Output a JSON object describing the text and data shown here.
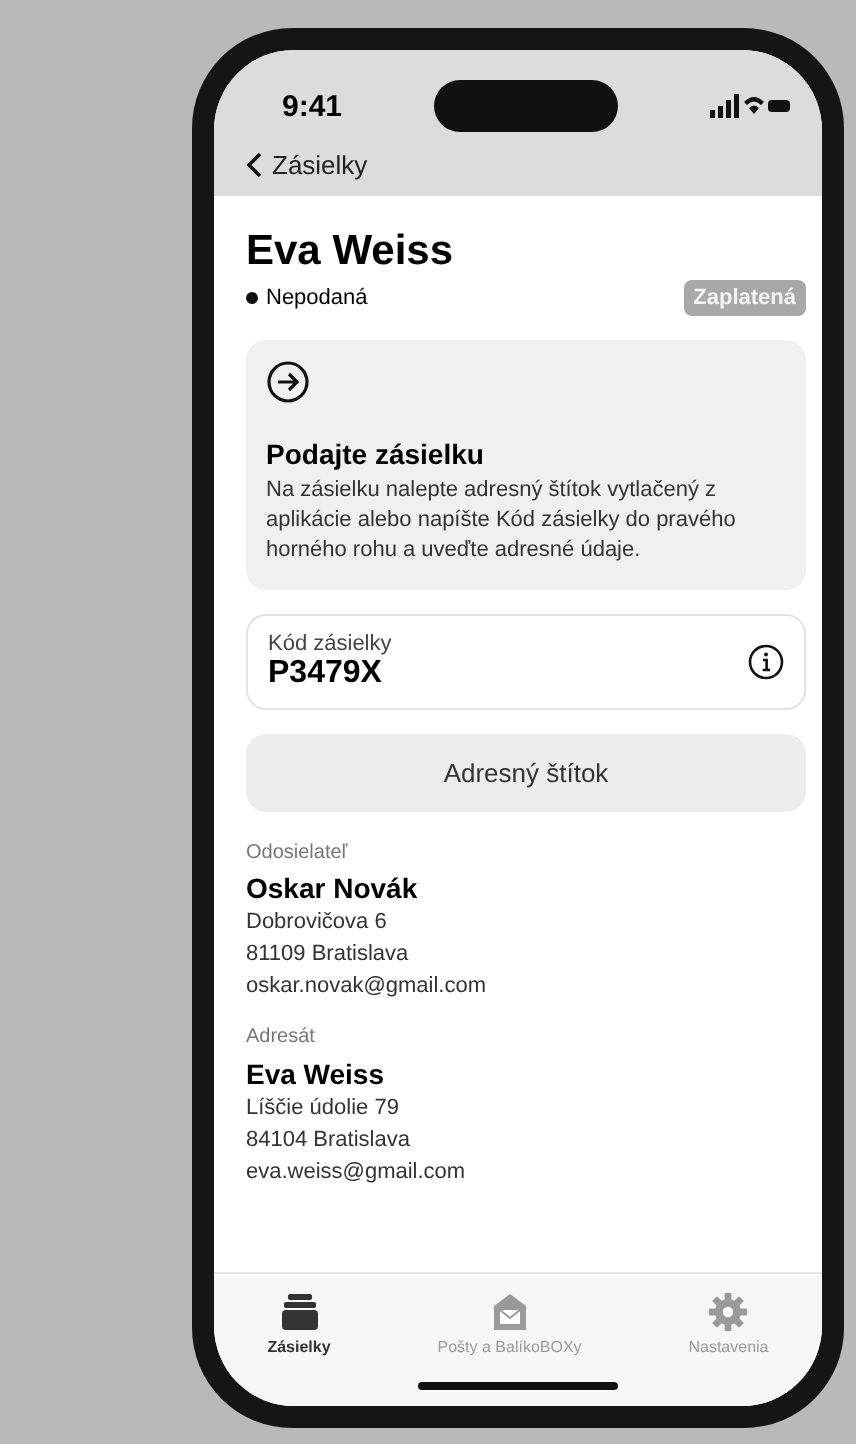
{
  "status_bar": {
    "time": "9:41"
  },
  "nav": {
    "back_label": "Zásielky"
  },
  "shipment": {
    "recipient_name": "Eva Weiss",
    "status": "Nepodaná",
    "payment_badge": "Zaplatená"
  },
  "info_card": {
    "title": "Podajte zásielku",
    "text": "Na zásielku nalepte adresný štítok vytlačený z aplikácie alebo napíšte Kód zásielky do pravého horného rohu a uveďte adresné údaje."
  },
  "code_field": {
    "label": "Kód zásielky",
    "value": "P3479X"
  },
  "address_label_button": "Adresný štítok",
  "parties": [
    {
      "role": "Odosielateľ",
      "name": "Oskar Novák",
      "street": "Dobrovičova 6",
      "city": "81109 Bratislava",
      "email": "oskar.novak@gmail.com"
    },
    {
      "role": "Adresát",
      "name": "Eva Weiss",
      "street": "Líščie údolie 79",
      "city": "84104 Bratislava",
      "email": "eva.weiss@gmail.com"
    }
  ],
  "tabs": [
    {
      "label": "Zásielky",
      "selected": true,
      "kind": "box"
    },
    {
      "label": "Pošty a BalíkoBOXy",
      "selected": false,
      "kind": "post"
    },
    {
      "label": "Nastavenia",
      "selected": false,
      "kind": "gear"
    }
  ]
}
